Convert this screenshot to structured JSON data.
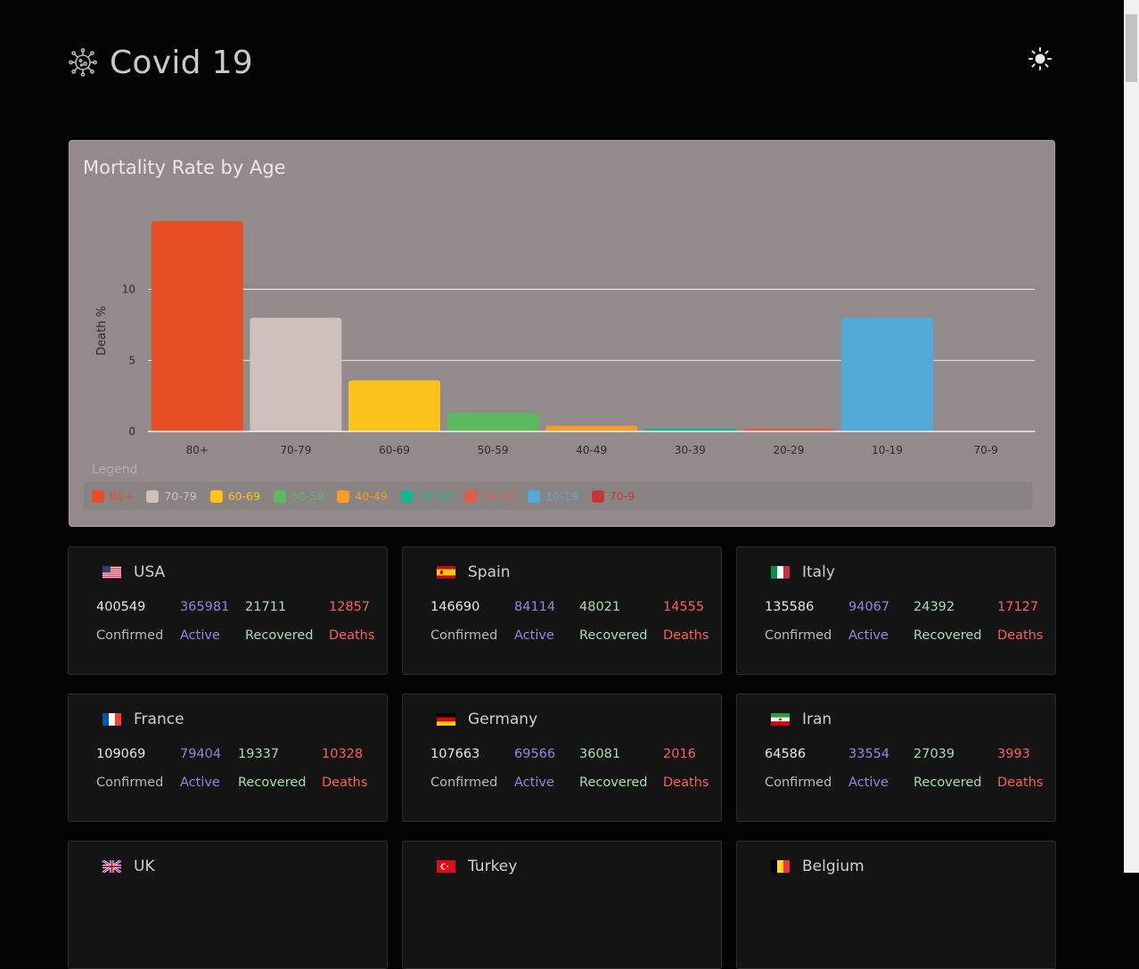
{
  "app": {
    "title": "Covid 19",
    "logo_icon": "virus-icon",
    "theme_toggle_icon": "sun-icon"
  },
  "chart": {
    "title": "Mortality Rate by Age",
    "legend_title": "Legend"
  },
  "chart_data": {
    "type": "bar",
    "title": "Mortality Rate by Age",
    "xlabel": "",
    "ylabel": "Death %",
    "categories": [
      "80+",
      "70-79",
      "60-69",
      "50-59",
      "40-49",
      "30-39",
      "20-29",
      "10-19",
      "70-9"
    ],
    "values": [
      14.8,
      8.0,
      3.6,
      1.3,
      0.4,
      0.2,
      0.2,
      8.0,
      0
    ],
    "colors": [
      "#e64e26",
      "#cec1bc",
      "#fcc21c",
      "#5cba5e",
      "#f99b28",
      "#19b394",
      "#e35c47",
      "#53aad6",
      "#c43834"
    ],
    "yticks": [
      0,
      5,
      10
    ],
    "ylim": [
      0,
      14.8
    ],
    "grid": true,
    "legend_position": "bottom"
  },
  "labels": {
    "confirmed": "Confirmed",
    "active": "Active",
    "recovered": "Recovered",
    "deaths": "Deaths"
  },
  "countries": [
    {
      "name": "USA",
      "flag": "usa-flag-icon",
      "confirmed": "400549",
      "active": "365981",
      "recovered": "21711",
      "deaths": "12857"
    },
    {
      "name": "Spain",
      "flag": "spain-flag-icon",
      "confirmed": "146690",
      "active": "84114",
      "recovered": "48021",
      "deaths": "14555"
    },
    {
      "name": "Italy",
      "flag": "italy-flag-icon",
      "confirmed": "135586",
      "active": "94067",
      "recovered": "24392",
      "deaths": "17127"
    },
    {
      "name": "France",
      "flag": "france-flag-icon",
      "confirmed": "109069",
      "active": "79404",
      "recovered": "19337",
      "deaths": "10328"
    },
    {
      "name": "Germany",
      "flag": "germany-flag-icon",
      "confirmed": "107663",
      "active": "69566",
      "recovered": "36081",
      "deaths": "2016"
    },
    {
      "name": "Iran",
      "flag": "iran-flag-icon",
      "confirmed": "64586",
      "active": "33554",
      "recovered": "27039",
      "deaths": "3993"
    },
    {
      "name": "UK",
      "flag": "uk-flag-icon"
    },
    {
      "name": "Turkey",
      "flag": "turkey-flag-icon"
    },
    {
      "name": "Belgium",
      "flag": "belgium-flag-icon"
    }
  ]
}
